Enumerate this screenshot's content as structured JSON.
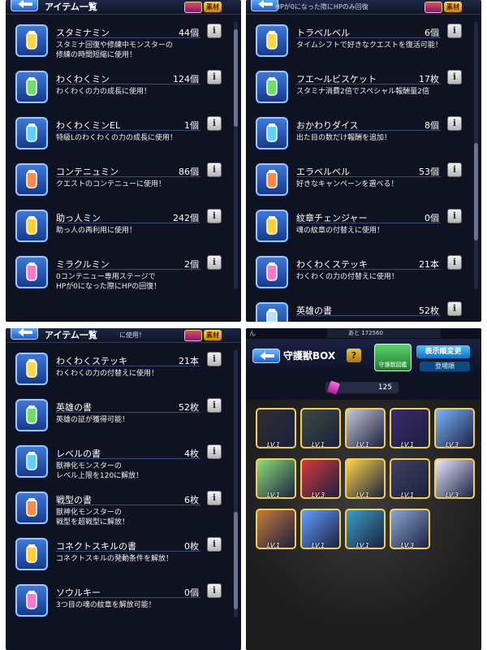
{
  "panels": {
    "top_left": {
      "title": "アイテム一覧",
      "badge": "素材",
      "items": [
        {
          "name": "スタミナミン",
          "count": "44個",
          "desc": "スタミナ回復や修練中モンスターの\n修練の時間短縮に使用！",
          "icon": "stamina-jar-icon"
        },
        {
          "name": "わくわくミン",
          "count": "124個",
          "desc": "わくわくの力の成長に使用！",
          "icon": "wakuwaku-bottle-icon"
        },
        {
          "name": "わくわくミンEL",
          "count": "1個",
          "desc": "特級Lのわくわくの力の成長に使用！",
          "icon": "wakuwaku-el-bottle-icon"
        },
        {
          "name": "コンテニュミン",
          "count": "86個",
          "desc": "クエストのコンテニューに使用！",
          "icon": "continue-bottle-icon"
        },
        {
          "name": "助っ人ミン",
          "count": "242個",
          "desc": "助っ人の再利用に使用！",
          "icon": "helper-figure-icon"
        },
        {
          "name": "ミラクルミン",
          "count": "2個",
          "desc": "0コンテニュー専用ステージで\nHPが0になった際にHPの回復！",
          "icon": "miracle-bottle-icon"
        }
      ]
    },
    "top_right": {
      "title": "アイテム一覧",
      "header_sub": "HPが0になった際にHPのみ回復",
      "badge": "素材",
      "items": [
        {
          "name": "トラベルベル",
          "count": "6個",
          "desc": "タイムシフトで好きなクエストを復活可能！",
          "icon": "travel-bell-icon"
        },
        {
          "name": "フエ～ルビスケット",
          "count": "17枚",
          "desc": "スタミナ消費2倍でスペシャル報酬量2倍",
          "icon": "biscuit-icon"
        },
        {
          "name": "おかわりダイス",
          "count": "8個",
          "desc": "出た目の数だけ報酬を追加！",
          "icon": "dice-icon"
        },
        {
          "name": "エラベルベル",
          "count": "53個",
          "desc": "好きなキャンペーンを選べる！",
          "icon": "erabell-icon"
        },
        {
          "name": "紋章チェンジャー",
          "count": "0個",
          "desc": "魂の紋章の付替えに使用！",
          "icon": "emblem-changer-icon"
        },
        {
          "name": "わくわくステッキ",
          "count": "21本",
          "desc": "わくわくの力の付替えに使用！",
          "icon": "wakuwaku-stick-icon"
        },
        {
          "name": "英雄の書",
          "count": "52枚",
          "desc": "",
          "icon": "hero-book-icon"
        }
      ]
    },
    "bottom_left": {
      "title": "アイテム一覧",
      "header_sub": "に使用！",
      "badge": "素材",
      "items": [
        {
          "name": "わくわくステッキ",
          "count": "21本",
          "desc": "わくわくの力の付替えに使用！",
          "icon": "wakuwaku-stick-icon"
        },
        {
          "name": "英雄の書",
          "count": "52枚",
          "desc": "英雄の証が獲得可能！",
          "icon": "hero-book-icon"
        },
        {
          "name": "レベルの書",
          "count": "4枚",
          "desc": "獣神化モンスターの\nレベル上限を120に解放！",
          "icon": "level-book-icon"
        },
        {
          "name": "戦型の書",
          "count": "6枚",
          "desc": "獣神化モンスターの\n戦型を超戦型に解放！",
          "icon": "battle-book-icon"
        },
        {
          "name": "コネクトスキルの書",
          "count": "0枚",
          "desc": "コネクトスキルの発動条件を解放！",
          "icon": "connect-book-icon"
        },
        {
          "name": "ソウルキー",
          "count": "0個",
          "desc": "3つ目の魂の紋章を解放可能！",
          "icon": "soul-key-icon"
        }
      ]
    },
    "bottom_right": {
      "top_text": "ん",
      "stat_text": "あと 172560",
      "title": "守護獣BOX",
      "help_label": "?",
      "guard_label": "守護獣図鑑",
      "sort_label": "表示順変更",
      "sort_order": "登場順",
      "count": "125",
      "slots": [
        {
          "lv": "LV.1",
          "icon": "guardian-1-icon"
        },
        {
          "lv": "LV.1",
          "icon": "guardian-2-icon"
        },
        {
          "lv": "LV.1",
          "icon": "guardian-3-icon"
        },
        {
          "lv": "LV.1",
          "icon": "guardian-4-icon"
        },
        {
          "lv": "LV.3",
          "icon": "guardian-5-icon"
        },
        {
          "lv": "LV.1",
          "icon": "guardian-6-icon"
        },
        {
          "lv": "LV.3",
          "icon": "guardian-7-icon"
        },
        {
          "lv": "LV.1",
          "icon": "guardian-8-icon"
        },
        {
          "lv": "LV.1",
          "icon": "guardian-9-icon"
        },
        {
          "lv": "LV.3",
          "icon": "guardian-10-icon"
        },
        {
          "lv": "LV.1",
          "icon": "guardian-11-icon"
        },
        {
          "lv": "LV.1",
          "icon": "guardian-12-icon"
        },
        {
          "lv": "LV.1",
          "icon": "guardian-13-icon"
        },
        {
          "lv": "LV.3",
          "icon": "guardian-14-icon"
        }
      ]
    }
  },
  "info_label": "i"
}
